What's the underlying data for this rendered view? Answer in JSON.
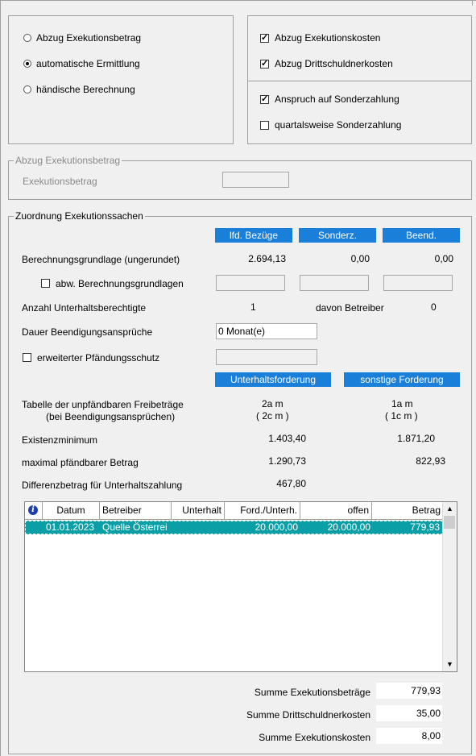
{
  "modes": {
    "option1": "Abzug Exekutionsbetrag",
    "option2": "automatische Ermittlung",
    "option3": "händische Berechnung"
  },
  "deductions": {
    "option1": "Abzug Exekutionskosten",
    "option2": "Abzug Drittschuldnerkosten",
    "option3": "Anspruch auf Sonderzahlung",
    "option4": "quartalsweise Sonderzahlung"
  },
  "exec_group": {
    "legend": "Abzug Exekutionsbetrag",
    "label": "Exekutionsbetrag",
    "value": ""
  },
  "assign": {
    "legend": "Zuordnung Exekutionssachen",
    "col1": "lfd. Bezüge",
    "col2": "Sonderz.",
    "col3": "Beend.",
    "basis_label": "Berechnungsgrundlage (ungerundet)",
    "basis1": "2.694,13",
    "basis2": "0,00",
    "basis3": "0,00",
    "abw_label": "abw. Berechnungsgrundlagen",
    "count_label": "Anzahl Unterhaltsberechtigte",
    "count_value": "1",
    "davon_label": "davon Betreiber",
    "davon_value": "0",
    "dauer_label": "Dauer Beendigungsansprüche",
    "dauer_value": "0  Monat(e)",
    "schutz_label": "erweiterter Pfändungsschutz",
    "btn_unterhalt": "Unterhaltsforderung",
    "btn_sonstige": "sonstige Forderung",
    "tabelle_label1": "Tabelle der unpfändbaren Freibeträge",
    "tabelle_label2": "(bei Beendigungsansprüchen)",
    "tab_u1": "2a m",
    "tab_u2": "( 2c m )",
    "tab_s1": "1a m",
    "tab_s2": "( 1c m )",
    "exmin_label": "Existenzminimum",
    "exmin_u": "1.403,40",
    "exmin_s": "1.871,20",
    "max_label": "maximal pfändbarer Betrag",
    "max_u": "1.290,73",
    "max_s": "822,93",
    "diff_label": "Differenzbetrag für Unterhaltszahlung",
    "diff_value": "467,80"
  },
  "table": {
    "headers": [
      "Datum",
      "Betreiber",
      "Unterhalt",
      "Ford./Unterh.",
      "offen",
      "Betrag"
    ],
    "rows": [
      {
        "datum": "01.01.2023",
        "betreiber": "Quelle Österrei",
        "unterhalt": "",
        "ford": "20.000,00",
        "offen": "20.000,00",
        "betrag": "779,93"
      }
    ]
  },
  "totals": {
    "exek_label": "Summe Exekutionsbeträge",
    "exek_value": "779,93",
    "dritt_label": "Summe Drittschuldnerkosten",
    "dritt_value": "35,00",
    "kosten_label": "Summe Exekutionskosten",
    "kosten_value": "8,00"
  },
  "colors": {
    "accent": "#1a7fd8",
    "selection": "#0a9fa7"
  }
}
